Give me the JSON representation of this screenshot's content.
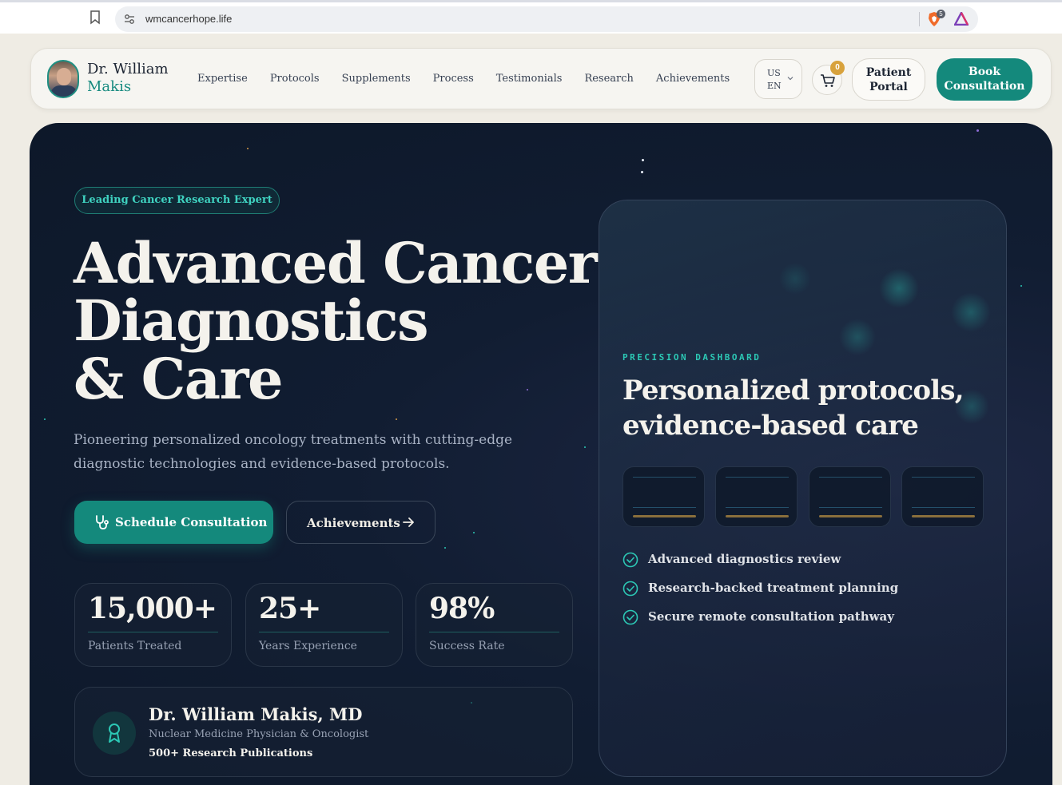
{
  "browser": {
    "url": "wmcancerhope.life",
    "shields_count": "5"
  },
  "header": {
    "brand_first": "Dr. William",
    "brand_last": "Makis",
    "nav": [
      "Expertise",
      "Protocols",
      "Supplements",
      "Process",
      "Testimonials",
      "Research",
      "Achievements"
    ],
    "lang_region": "US",
    "lang_code": "EN",
    "cart_count": "0",
    "portal_line1": "Patient",
    "portal_line2": "Portal",
    "book_line1": "Book",
    "book_line2": "Consultation"
  },
  "hero": {
    "tagline": "Leading Cancer Research Expert",
    "title_line1": "Advanced Cancer",
    "title_line2": "Diagnostics",
    "title_line3": "& Care",
    "lead": "Pioneering personalized oncology treatments with cutting-edge diagnostic technologies and evidence-based protocols.",
    "cta_primary": "Schedule Consultation",
    "cta_secondary": "Achievements",
    "stats": [
      {
        "value": "15,000+",
        "label": "Patients Treated"
      },
      {
        "value": "25+",
        "label": "Years Experience"
      },
      {
        "value": "98%",
        "label": "Success Rate"
      }
    ],
    "doctor": {
      "name": "Dr. William Makis, MD",
      "role": "Nuclear Medicine Physician & Oncologist",
      "publications": "500+ Research Publications"
    }
  },
  "dashboard": {
    "eyebrow": "PRECISION DASHBOARD",
    "title_line1": "Personalized protocols,",
    "title_line2": "evidence-based care",
    "checklist": [
      "Advanced diagnostics review",
      "Research-backed treatment planning",
      "Secure remote consultation pathway"
    ]
  },
  "colors": {
    "accent": "#14897c",
    "accent_light": "#2cc8b5",
    "hero_bg": "#0f1b2e",
    "page_bg": "#efece4",
    "badge": "#d8a23c"
  }
}
